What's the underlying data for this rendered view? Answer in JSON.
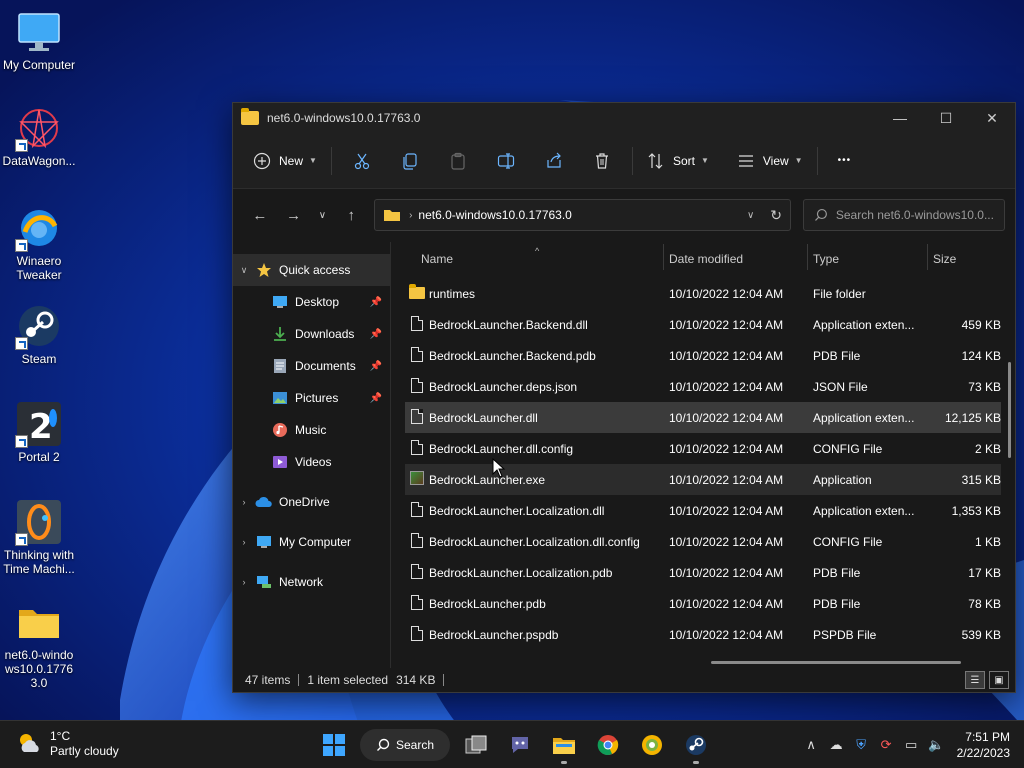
{
  "desktop": {
    "icons": [
      {
        "label": "My Computer"
      },
      {
        "label": "DataWagon..."
      },
      {
        "label": "Winaero Tweaker"
      },
      {
        "label": "Steam"
      },
      {
        "label": "Portal 2"
      },
      {
        "label": "Thinking with Time Machi..."
      },
      {
        "label": "net6.0-windows10.0.17763.0"
      }
    ]
  },
  "window": {
    "title": "net6.0-windows10.0.17763.0",
    "controls": {
      "minimize": "—",
      "maximize": "☐",
      "close": "✕"
    }
  },
  "commandbar": {
    "new_label": "New",
    "sort_label": "Sort",
    "view_label": "View",
    "more_label": "•••"
  },
  "address": {
    "path": "net6.0-windows10.0.17763.0",
    "search_placeholder": "Search net6.0-windows10.0...."
  },
  "navpane": {
    "quick_access": "Quick access",
    "items": [
      {
        "label": "Desktop",
        "icon": "desktop-icon",
        "pinned": true
      },
      {
        "label": "Downloads",
        "icon": "downloads-icon",
        "pinned": true
      },
      {
        "label": "Documents",
        "icon": "documents-icon",
        "pinned": true
      },
      {
        "label": "Pictures",
        "icon": "pictures-icon",
        "pinned": true
      },
      {
        "label": "Music",
        "icon": "music-icon",
        "pinned": false
      },
      {
        "label": "Videos",
        "icon": "videos-icon",
        "pinned": false
      }
    ],
    "onedrive": "OneDrive",
    "mycomputer": "My Computer",
    "network": "Network"
  },
  "columns": {
    "name": "Name",
    "date": "Date modified",
    "type": "Type",
    "size": "Size"
  },
  "files": [
    {
      "name": "runtimes",
      "date": "10/10/2022 12:04 AM",
      "type": "File folder",
      "size": "",
      "kind": "folder"
    },
    {
      "name": "BedrockLauncher.Backend.dll",
      "date": "10/10/2022 12:04 AM",
      "type": "Application exten...",
      "size": "459 KB",
      "kind": "file"
    },
    {
      "name": "BedrockLauncher.Backend.pdb",
      "date": "10/10/2022 12:04 AM",
      "type": "PDB File",
      "size": "124 KB",
      "kind": "file"
    },
    {
      "name": "BedrockLauncher.deps.json",
      "date": "10/10/2022 12:04 AM",
      "type": "JSON File",
      "size": "73 KB",
      "kind": "file"
    },
    {
      "name": "BedrockLauncher.dll",
      "date": "10/10/2022 12:04 AM",
      "type": "Application exten...",
      "size": "12,125 KB",
      "kind": "file",
      "state": "selected"
    },
    {
      "name": "BedrockLauncher.dll.config",
      "date": "10/10/2022 12:04 AM",
      "type": "CONFIG File",
      "size": "2 KB",
      "kind": "file"
    },
    {
      "name": "BedrockLauncher.exe",
      "date": "10/10/2022 12:04 AM",
      "type": "Application",
      "size": "315 KB",
      "kind": "exe",
      "state": "hover"
    },
    {
      "name": "BedrockLauncher.Localization.dll",
      "date": "10/10/2022 12:04 AM",
      "type": "Application exten...",
      "size": "1,353 KB",
      "kind": "file"
    },
    {
      "name": "BedrockLauncher.Localization.dll.config",
      "date": "10/10/2022 12:04 AM",
      "type": "CONFIG File",
      "size": "1 KB",
      "kind": "file"
    },
    {
      "name": "BedrockLauncher.Localization.pdb",
      "date": "10/10/2022 12:04 AM",
      "type": "PDB File",
      "size": "17 KB",
      "kind": "file"
    },
    {
      "name": "BedrockLauncher.pdb",
      "date": "10/10/2022 12:04 AM",
      "type": "PDB File",
      "size": "78 KB",
      "kind": "file"
    },
    {
      "name": "BedrockLauncher.pspdb",
      "date": "10/10/2022 12:04 AM",
      "type": "PSPDB File",
      "size": "539 KB",
      "kind": "file"
    }
  ],
  "status": {
    "count": "47 items",
    "selected": "1 item selected",
    "size": "314 KB"
  },
  "taskbar": {
    "weather_temp": "1°C",
    "weather_desc": "Partly cloudy",
    "search_label": "Search",
    "time": "7:51 PM",
    "date": "2/22/2023"
  },
  "colors": {
    "accent": "#0078d4",
    "folder": "#f5c542"
  }
}
